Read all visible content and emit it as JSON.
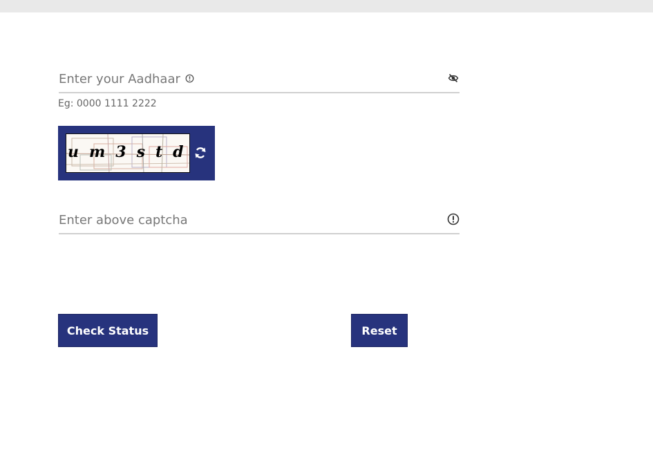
{
  "aadhaar": {
    "placeholder": "Enter your Aadhaar",
    "hint": "Eg: 0000 1111 2222",
    "info_icon": "info-circle-icon",
    "visibility_icon": "eye-off-icon"
  },
  "captcha": {
    "text": "um3std",
    "refresh_icon": "refresh-icon",
    "input_placeholder": "Enter above captcha",
    "info_icon": "info-circle-icon"
  },
  "buttons": {
    "check_status": "Check Status",
    "reset": "Reset"
  },
  "colors": {
    "primary": "#27337d",
    "underline": "#cfcfcf",
    "placeholder": "#777777",
    "topbar": "#e9e9e9"
  }
}
